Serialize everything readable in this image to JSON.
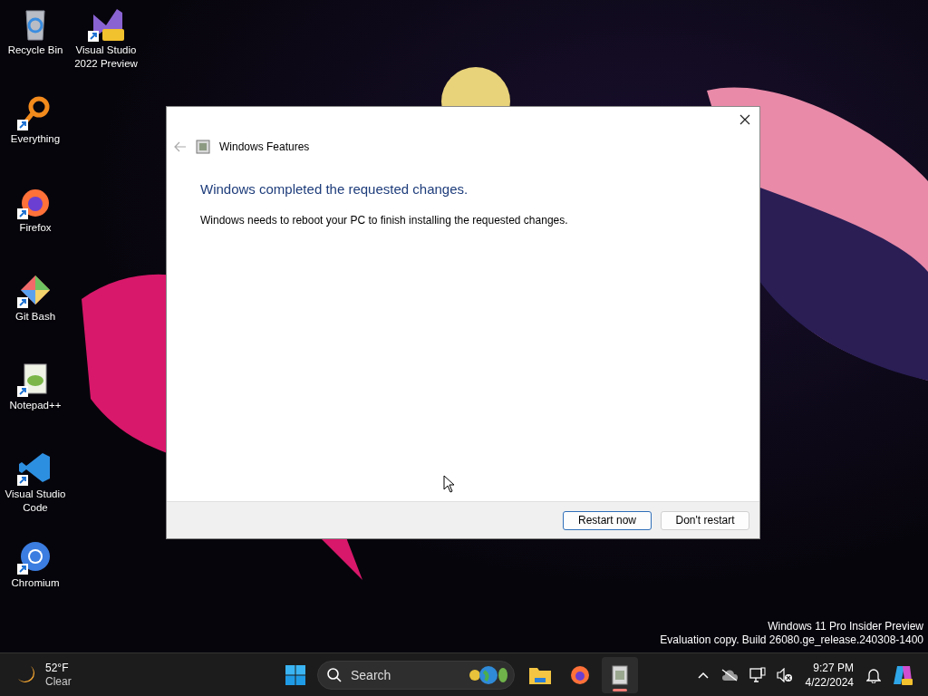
{
  "desktop_icons": [
    {
      "label": "Recycle Bin",
      "shortcut": false
    },
    {
      "label": "Visual Studio 2022 Preview",
      "shortcut": true
    },
    {
      "label": "Everything",
      "shortcut": true
    },
    {
      "label": "Firefox",
      "shortcut": true
    },
    {
      "label": "Git Bash",
      "shortcut": true
    },
    {
      "label": "Notepad++",
      "shortcut": true
    },
    {
      "label": "Visual Studio Code",
      "shortcut": true
    },
    {
      "label": "Chromium",
      "shortcut": true
    }
  ],
  "dialog": {
    "title": "Windows Features",
    "back_disabled": true,
    "heading": "Windows completed the requested changes.",
    "message": "Windows needs to reboot your PC to finish installing the requested changes.",
    "buttons": [
      {
        "label": "Restart now",
        "default": true
      },
      {
        "label": "Don't restart",
        "default": false
      }
    ]
  },
  "edition_notice": [
    "Windows 11 Pro Insider Preview",
    "Evaluation copy. Build 26080.ge_release.240308-1400"
  ],
  "taskbar": {
    "weather": {
      "temperature": "52°F",
      "condition": "Clear"
    },
    "search": {
      "placeholder": "Search"
    },
    "apps": [
      {
        "kind": "explorer",
        "active": false
      },
      {
        "kind": "firefox",
        "active": false
      },
      {
        "kind": "features",
        "active": true
      }
    ],
    "clock": {
      "time": "9:27 PM",
      "date": "4/22/2024"
    }
  }
}
